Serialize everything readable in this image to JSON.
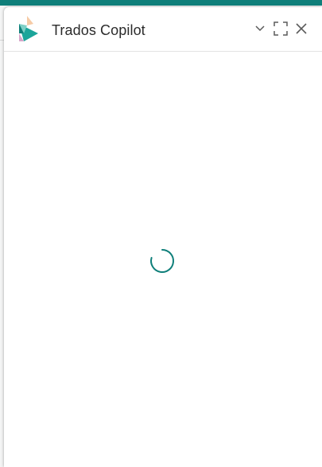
{
  "window": {
    "title": "Trados Copilot"
  },
  "header": {
    "logo_icon": "trados-logo-icon",
    "collapse_icon": "chevron-down-icon",
    "expand_icon": "fullscreen-icon",
    "close_icon": "close-icon"
  },
  "body": {
    "state": "loading",
    "spinner_icon": "loading-spinner-icon"
  },
  "colors": {
    "accent": "#0f7f7a",
    "logo_teal": "#1ba59a",
    "logo_light": "#f5c9a5",
    "icon": "#5a5a5a"
  }
}
